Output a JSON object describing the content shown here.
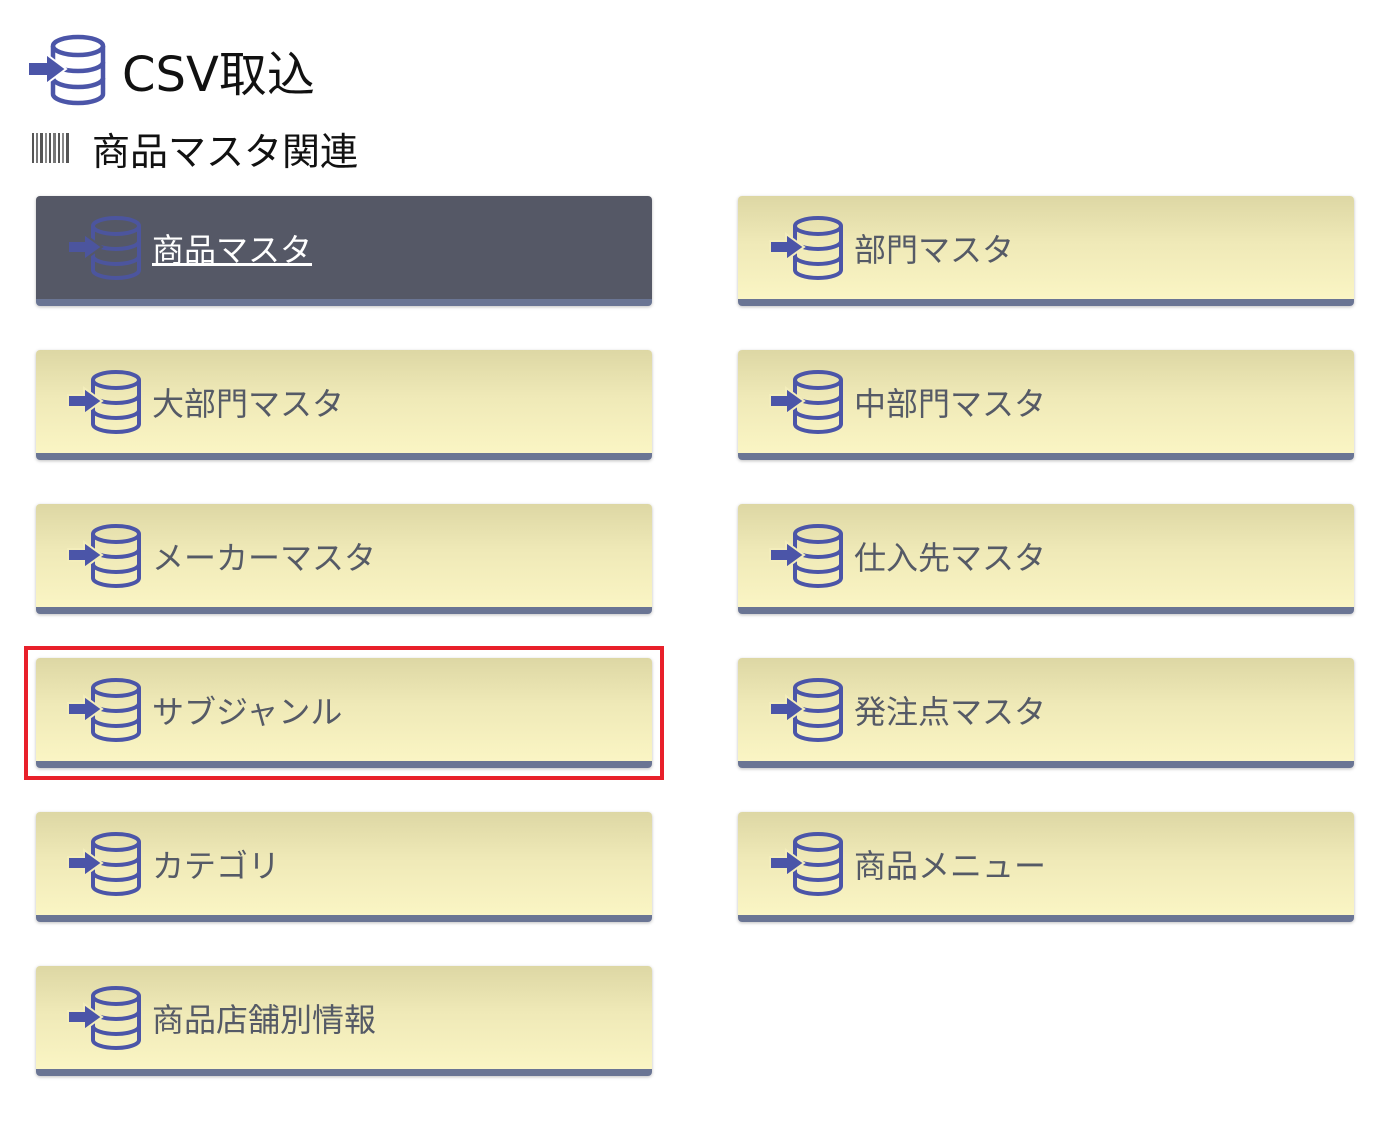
{
  "header": {
    "title": "CSV取込",
    "icon": "database-import-icon"
  },
  "section": {
    "title": "商品マスタ関連",
    "icon": "barcode-icon"
  },
  "colors": {
    "tile_bg": "#faf5c4",
    "tile_active_bg": "#555866",
    "tile_bottom_border": "#6a7594",
    "icon_blue": "#4b55a8",
    "highlight_red": "#e8202a"
  },
  "tiles": [
    {
      "label": "商品マスタ",
      "icon": "database-import-icon",
      "active": true
    },
    {
      "label": "部門マスタ",
      "icon": "database-import-icon",
      "active": false
    },
    {
      "label": "大部門マスタ",
      "icon": "database-import-icon",
      "active": false
    },
    {
      "label": "中部門マスタ",
      "icon": "database-import-icon",
      "active": false
    },
    {
      "label": "メーカーマスタ",
      "icon": "database-import-icon",
      "active": false
    },
    {
      "label": "仕入先マスタ",
      "icon": "database-import-icon",
      "active": false
    },
    {
      "label": "サブジャンル",
      "icon": "database-import-icon",
      "active": false,
      "highlighted": true
    },
    {
      "label": "発注点マスタ",
      "icon": "database-import-icon",
      "active": false
    },
    {
      "label": "カテゴリ",
      "icon": "database-import-icon",
      "active": false
    },
    {
      "label": "商品メニュー",
      "icon": "database-import-icon",
      "active": false
    },
    {
      "label": "商品店舗別情報",
      "icon": "database-import-icon",
      "active": false
    }
  ]
}
